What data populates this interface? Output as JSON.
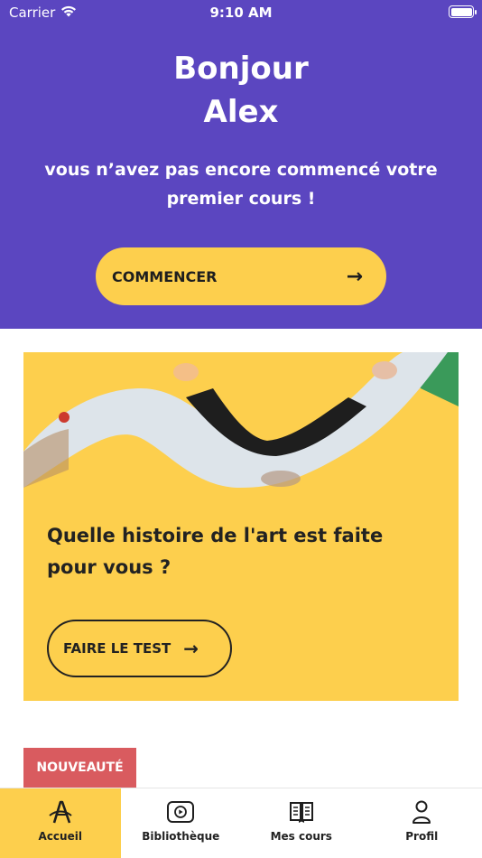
{
  "status_bar": {
    "carrier": "Carrier",
    "time": "9:10 AM",
    "battery_level": 1.0
  },
  "hero": {
    "greeting_line1": "Bonjour",
    "greeting_line2": "Alex",
    "subtitle": "vous n’avez pas encore commencé votre premier cours !",
    "cta_label": "COMMENCER",
    "cta_arrow": "→"
  },
  "card": {
    "title": "Quelle histoire de l'art est faite pour vous ?",
    "button_label": "FAIRE LE TEST",
    "button_arrow": "→"
  },
  "badge": {
    "label": "NOUVEAUTÉ"
  },
  "tabbar": {
    "tabs": [
      {
        "label": "Accueil",
        "icon": "home-logo-icon",
        "active": true
      },
      {
        "label": "Bibliothèque",
        "icon": "play-icon",
        "active": false
      },
      {
        "label": "Mes cours",
        "icon": "book-icon",
        "active": false
      },
      {
        "label": "Profil",
        "icon": "person-icon",
        "active": false
      }
    ]
  },
  "colors": {
    "primary": "#5b46c0",
    "accent": "#fdcf4d",
    "badge": "#d95b5f",
    "text": "#222222"
  }
}
